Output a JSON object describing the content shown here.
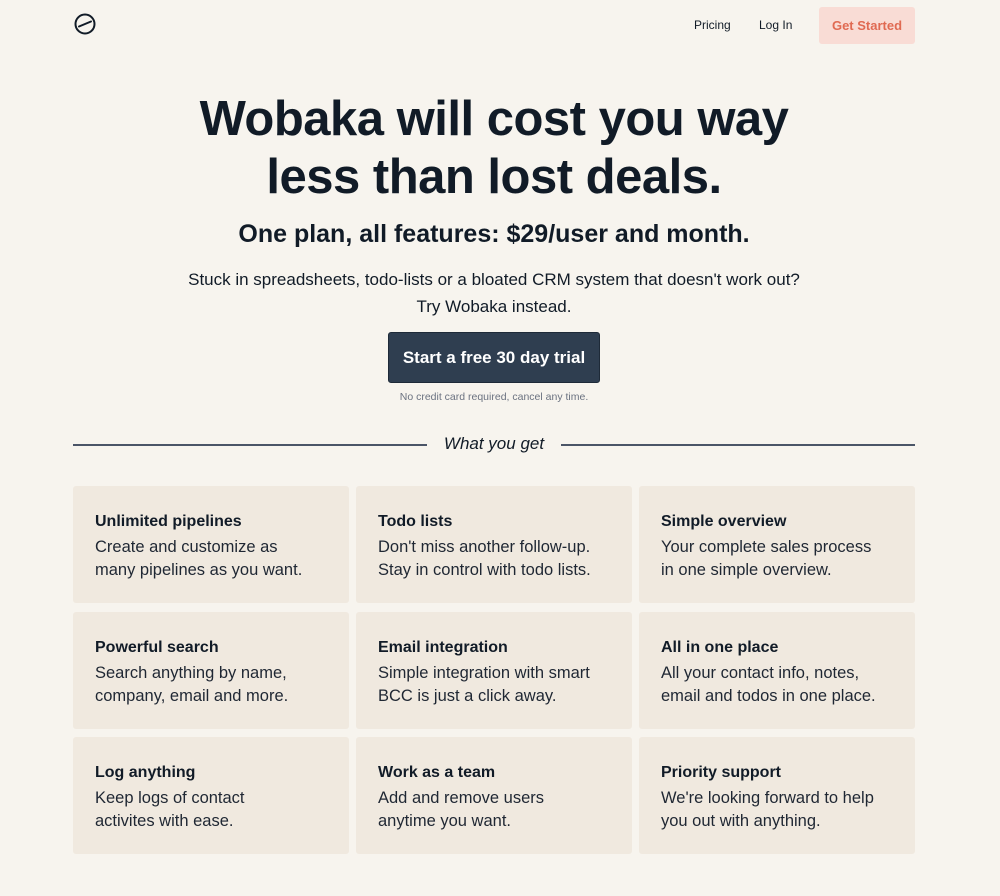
{
  "header": {
    "logo_icon": "clock-slash-icon",
    "nav": {
      "pricing": "Pricing",
      "login": "Log In"
    },
    "cta": "Get Started"
  },
  "hero": {
    "title_line1": "Wobaka will cost you way",
    "title_line2": "less than lost deals.",
    "subtitle": "One plan, all features: $29/user and month.",
    "desc_line1": "Stuck in spreadsheets, todo-lists or a bloated CRM system that doesn't work out?",
    "desc_line2": "Try Wobaka instead.",
    "trial_button": "Start a free 30 day trial",
    "trial_note": "No credit card required, cancel any time."
  },
  "section": {
    "label": "What you get"
  },
  "features": [
    {
      "title": "Unlimited pipelines",
      "line1": "Create and customize as",
      "line2": "many pipelines as you want."
    },
    {
      "title": "Todo lists",
      "line1": "Don't miss another follow-up.",
      "line2": "Stay in control with todo lists."
    },
    {
      "title": "Simple overview",
      "line1": "Your complete sales process",
      "line2": "in one simple overview."
    },
    {
      "title": "Powerful search",
      "line1": "Search anything by name,",
      "line2": "company, email and more."
    },
    {
      "title": "Email integration",
      "line1": "Simple integration with smart",
      "line2": "BCC is just a click away."
    },
    {
      "title": "All in one place",
      "line1": "All your contact info, notes,",
      "line2": "email and todos in one place."
    },
    {
      "title": "Log anything",
      "line1": "Keep logs of contact",
      "line2": "activites with ease."
    },
    {
      "title": "Work as a team",
      "line1": "Add and remove users",
      "line2": "anytime you want."
    },
    {
      "title": "Priority support",
      "line1": "We're looking forward to help",
      "line2": "you out with anything."
    }
  ],
  "colors": {
    "background": "#f7f4ee",
    "card": "#f0e9df",
    "primary_button": "#2f3e50",
    "accent_button_bg": "#f9dcd5",
    "accent_button_text": "#e06a52",
    "text": "#111b27"
  }
}
